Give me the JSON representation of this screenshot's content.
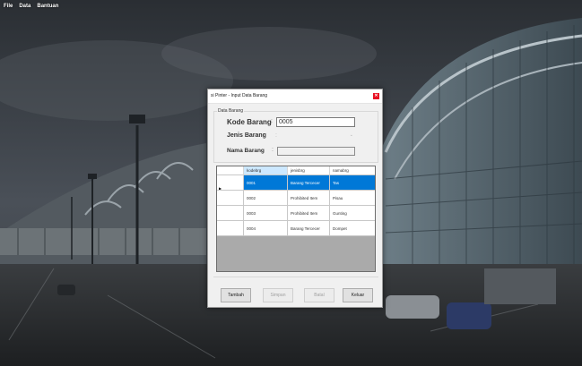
{
  "menu": {
    "items": [
      "File",
      "Data",
      "Bantuan"
    ]
  },
  "dialog": {
    "title": "si Pinter - Input Data Barang",
    "close_glyph": "✕",
    "group_title": "Data Barang",
    "fields": {
      "kode_label": "Kode Barang",
      "kode_value": "0005",
      "jenis_label": "Jenis Barang",
      "nama_label": "Nama Barang",
      "colon": ":"
    },
    "grid": {
      "columns": [
        "kodebrg",
        "jenisbrg",
        "namabrg"
      ],
      "rows": [
        [
          "0001",
          "Barang Tercecer",
          "Tas"
        ],
        [
          "0002",
          "Prohibited Item",
          "Pisau"
        ],
        [
          "0003",
          "Prohibited Item",
          "Gunting"
        ],
        [
          "0004",
          "Barang Tercecer",
          "Dompet"
        ]
      ],
      "selected_row": 0,
      "row_pointer": "▶"
    },
    "buttons": {
      "tambah": "Tambah",
      "simpan": "Simpan",
      "batal": "Batal",
      "keluar": "Keluar"
    }
  },
  "colors": {
    "selection": "#0078d7",
    "close": "#e81123"
  }
}
